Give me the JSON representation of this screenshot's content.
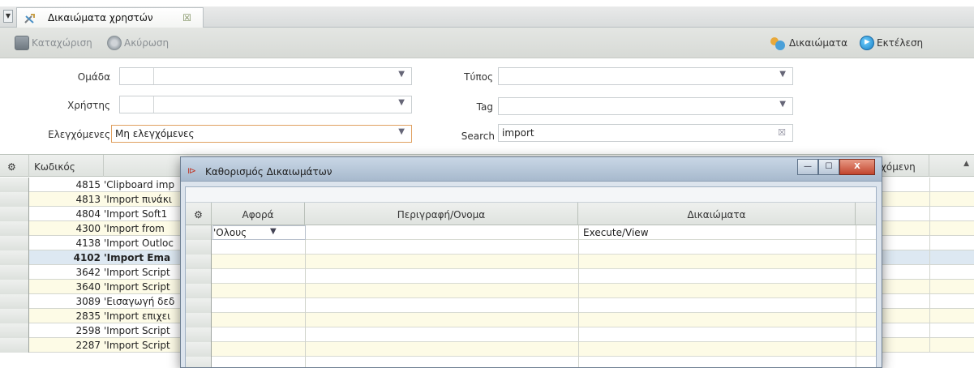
{
  "tab": {
    "label": "Δικαιώματα χρηστών",
    "close_glyph": "☒",
    "icon": "tools-icon"
  },
  "toolbar": {
    "save_label": "Καταχώριση",
    "cancel_label": "Ακύρωση",
    "rights_label": "Δικαιώματα",
    "execute_label": "Εκτέλεση"
  },
  "filters": {
    "group_label": "Ομάδα",
    "user_label": "Χρήστης",
    "checked_label": "Ελεγχόμενες",
    "checked_value": "Μη ελεγχόμενες",
    "type_label": "Τύπος",
    "tag_label": "Tag",
    "search_label": "Search",
    "search_value": "import"
  },
  "grid": {
    "columns": [
      "Κωδικός",
      "χόμενη"
    ],
    "rows": [
      {
        "code": "4815",
        "desc": "'Clipboard imp"
      },
      {
        "code": "4813",
        "desc": "'Import πινάκι"
      },
      {
        "code": "4804",
        "desc": "'Import Soft1"
      },
      {
        "code": "4300",
        "desc": "'Import from"
      },
      {
        "code": "4138",
        "desc": "'Import Outloc"
      },
      {
        "code": "4102",
        "desc": "'Import Ema"
      },
      {
        "code": "3642",
        "desc": "'Import Script"
      },
      {
        "code": "3640",
        "desc": "'Import Script"
      },
      {
        "code": "3089",
        "desc": "'Εισαγωγή δεδ"
      },
      {
        "code": "2835",
        "desc": "'Import επιχει"
      },
      {
        "code": "2598",
        "desc": "'Import Script"
      },
      {
        "code": "2287",
        "desc": "'Import Script"
      }
    ]
  },
  "dialog": {
    "title": "Καθορισμός Δικαιωμάτων",
    "columns": {
      "about": "Αφορά",
      "description": "Περιγραφή/Ονομα",
      "rights": "Δικαιώματα"
    },
    "row": {
      "about": "'Ολους",
      "rights": "Execute/View"
    },
    "buttons": {
      "minimize": "—",
      "maximize": "☐",
      "close": "X"
    }
  }
}
